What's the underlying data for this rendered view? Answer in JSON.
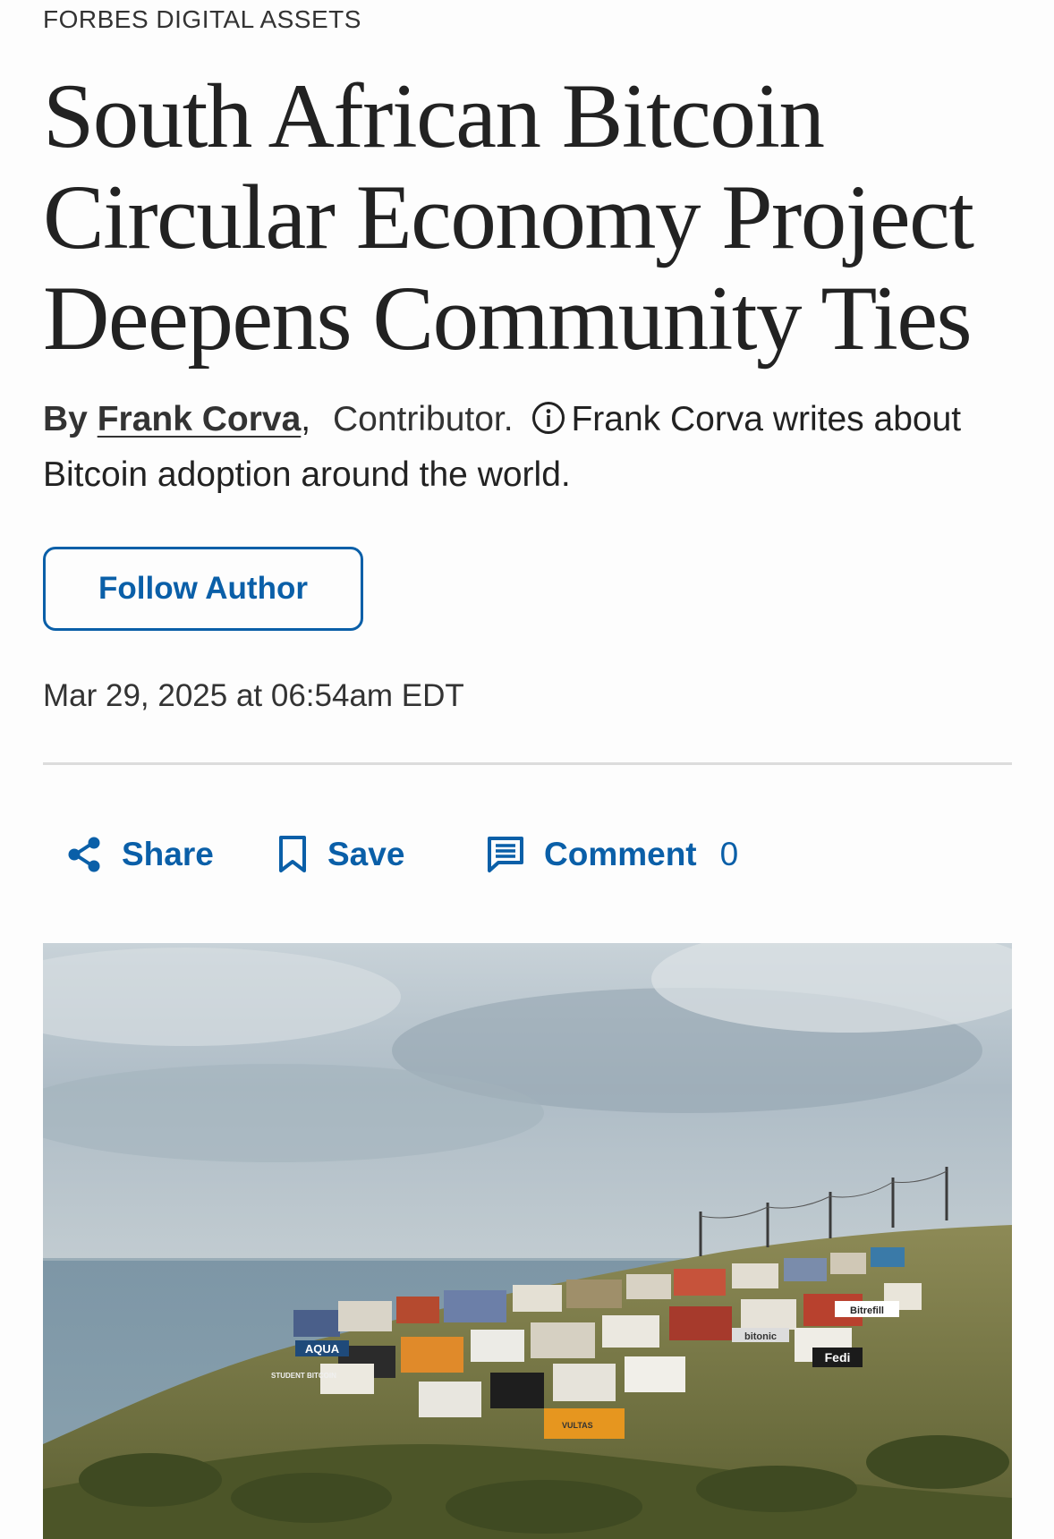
{
  "section": {
    "label": "FORBES DIGITAL ASSETS"
  },
  "article": {
    "headline": "South African Bitcoin Circular Economy Project Deepens Community Ties",
    "byline": {
      "by": "By",
      "author": "Frank Corva",
      "comma": ",",
      "role": "Contributor.",
      "bio": "Frank Corva writes about Bitcoin adoption around the world."
    },
    "follow_label": "Follow Author",
    "timestamp": "Mar 29, 2025 at 06:54am EDT"
  },
  "actions": {
    "share_label": "Share",
    "save_label": "Save",
    "comment_label": "Comment",
    "comment_count": "0"
  },
  "hero": {
    "signs": [
      "AQUA",
      "bitonic",
      "Bitrefill",
      "Fedi",
      "STUDENT BITCOIN",
      "VULTAS"
    ]
  },
  "colors": {
    "accent": "#0a5fa8",
    "text": "#222222",
    "divider": "#dcdcdc"
  }
}
